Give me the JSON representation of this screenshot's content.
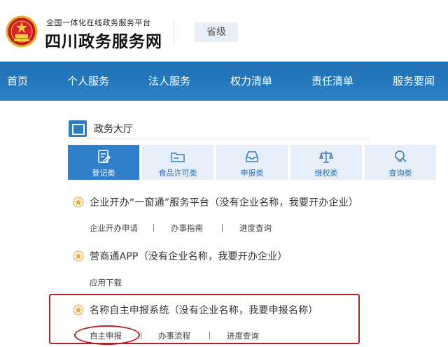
{
  "header": {
    "platform_subtitle": "全国一体化在线政务服务平台",
    "platform_title": "四川政务服务网",
    "level_button": "省级"
  },
  "nav": {
    "items": [
      "首页",
      "个人服务",
      "法人服务",
      "权力清单",
      "责任清单",
      "服务要闻"
    ]
  },
  "hall": {
    "title": "政务大厅",
    "tabs": [
      {
        "label": "登记类",
        "icon": "edit-document-icon",
        "active": true
      },
      {
        "label": "食品许可类",
        "icon": "folder-icon",
        "active": false
      },
      {
        "label": "申报类",
        "icon": "inbox-tray-icon",
        "active": false
      },
      {
        "label": "维权类",
        "icon": "scales-icon",
        "active": false
      },
      {
        "label": "查询类",
        "icon": "magnifier-icon",
        "active": false
      }
    ]
  },
  "services": [
    {
      "title": "企业开办“一窗通”服务平台（没有企业名称，我要开办企业）",
      "links": [
        "企业开办申请",
        "办事指南",
        "进度查询"
      ]
    },
    {
      "title": "营商通APP（没有企业名称，我要开办企业）",
      "links": [
        "应用下载"
      ]
    },
    {
      "title": "名称自主申报系统（没有企业名称，我要申报名称）",
      "links": [
        "自主申报",
        "办事流程",
        "进度查询"
      ]
    }
  ],
  "colors": {
    "nav_blue": "#2277bd",
    "active_tab": "#2f7fcb",
    "tab_bg": "#e6eef7",
    "highlight_red": "#b51f25",
    "star_gold": "#e6a23c"
  }
}
